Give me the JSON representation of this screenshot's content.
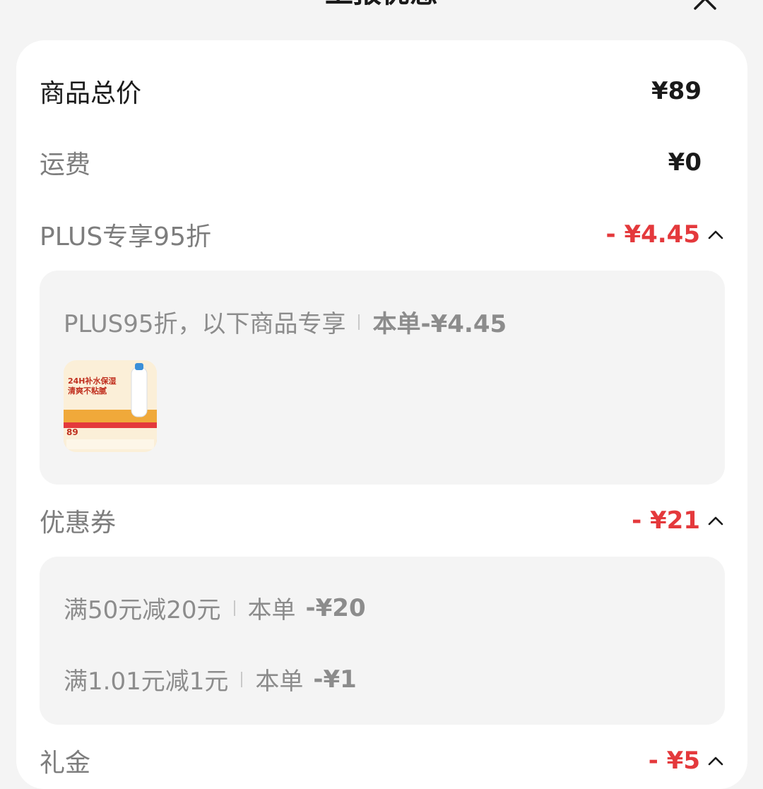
{
  "header": {
    "title": "上报优惠"
  },
  "summary": {
    "total_label": "商品总价",
    "total_value": "¥89",
    "shipping_label": "运费",
    "shipping_value": "¥0"
  },
  "plus": {
    "label": "PLUS专享95折",
    "amount": "- ¥4.45",
    "panel_text": "PLUS95折，以下商品专享",
    "panel_order": "本单-¥4.45",
    "product": {
      "title_line1": "24H补水保湿",
      "title_line2": "清爽不粘腻",
      "price": "89"
    }
  },
  "coupon": {
    "label": "优惠券",
    "amount": "- ¥21",
    "items": [
      {
        "text": "满50元减20元",
        "order_prefix": "本单",
        "order_value": "-¥20"
      },
      {
        "text": "满1.01元减1元",
        "order_prefix": "本单",
        "order_value": "-¥1"
      }
    ]
  },
  "gift": {
    "label": "礼金",
    "amount": "- ¥5"
  },
  "colors": {
    "accent": "#e4393c",
    "panel_bg": "#f4f4f4"
  }
}
